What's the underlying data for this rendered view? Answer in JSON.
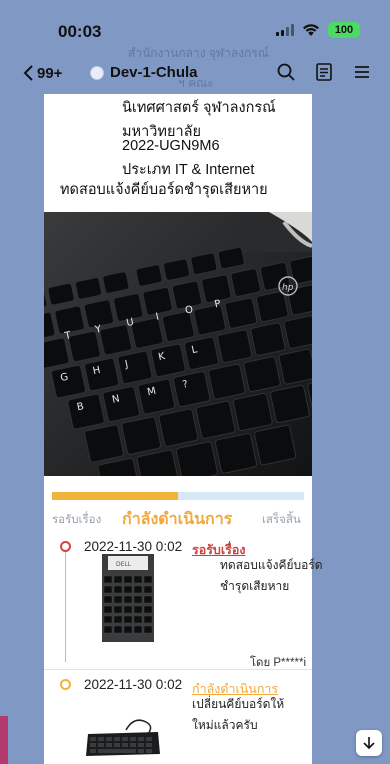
{
  "status_bar": {
    "time": "00:03",
    "battery": "100",
    "battery_color": "#4cd964"
  },
  "header": {
    "back_count": "99+",
    "chat_name": "Dev-1-Chula",
    "ghost_line_1": "สำนักงานกลาง จุฬาลงกรณ์",
    "ghost_line_2": "ฯ คณะ",
    "icons": [
      "search-icon",
      "notes-icon",
      "menu-icon"
    ],
    "background_color": "#7f98c4"
  },
  "message": {
    "lines": [
      "นิเทศศาสตร์ จุฬาลงกรณ์",
      "มหาวิทยาลัย",
      "2022-UGN9M6",
      "ประเภท IT & Internet",
      "ทดสอบแจ้งคีย์บอร์ดชำรุดเสียหาย"
    ],
    "progress": {
      "stages": [
        "รอรับเรื่อง",
        "กำลังดำเนินการ",
        "เสร็จสิ้น"
      ],
      "current_stage": 1,
      "fill_fraction": 0.5,
      "fill_color": "#f2b33d",
      "track_color": "#d5e8f3"
    },
    "timeline": [
      {
        "datetime": "2022-11-30 0:02",
        "status": "รอรับเรื่อง",
        "status_color": "#c8443b",
        "note_lines": [
          "ทดสอบแจ้งคีย์บอร์ด",
          "ชำรุดเสียหาย"
        ],
        "by": "โดย P*****i"
      },
      {
        "datetime": "2022-11-30 0:02",
        "status": "กำลังดำเนินการ",
        "status_color": "#f2a93b",
        "note_lines": [
          "เปลี่ยนคีย์บอร์ดให้",
          "ใหม่แล้วครับ"
        ]
      }
    ]
  }
}
